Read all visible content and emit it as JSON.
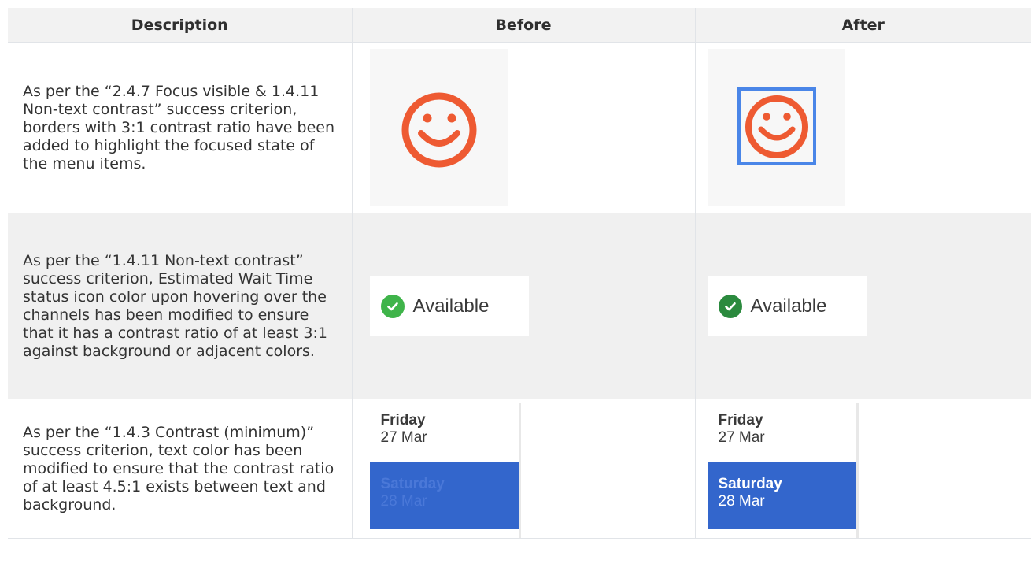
{
  "table": {
    "headers": [
      "Description",
      "Before",
      "After"
    ],
    "rows": [
      {
        "description": "As per the “2.4.7 Focus visible & 1.4.11 Non-text contrast” success criterion, borders with 3:1 contrast ratio have been added to highlight the focused state of the menu items."
      },
      {
        "description": "As per the “1.4.11 Non-text contrast” success criterion, Estimated Wait Time status icon color upon hovering over the channels has been modified to ensure that it has a contrast ratio of at least 3:1 against background or adjacent colors.",
        "before_label": "Available",
        "after_label": "Available"
      },
      {
        "description": "As per the “1.4.3 Contrast (minimum)” success criterion, text color has been modified to ensure that the contrast ratio of at least 4.5:1 exists between text and background.",
        "friday_day": "Friday",
        "friday_date": "27 Mar",
        "saturday_day": "Saturday",
        "saturday_date": "28 Mar"
      }
    ]
  },
  "colors": {
    "smiley": "#ee5a32",
    "focus_border": "#4a86e8",
    "available_before": "#3fb44a",
    "available_after": "#2b8a3e",
    "selected_bg": "#3366cc",
    "selected_text_before": "#4a78d8",
    "selected_text_after": "#ffffff"
  },
  "icons": [
    "smiley-icon",
    "check-circle-icon"
  ]
}
